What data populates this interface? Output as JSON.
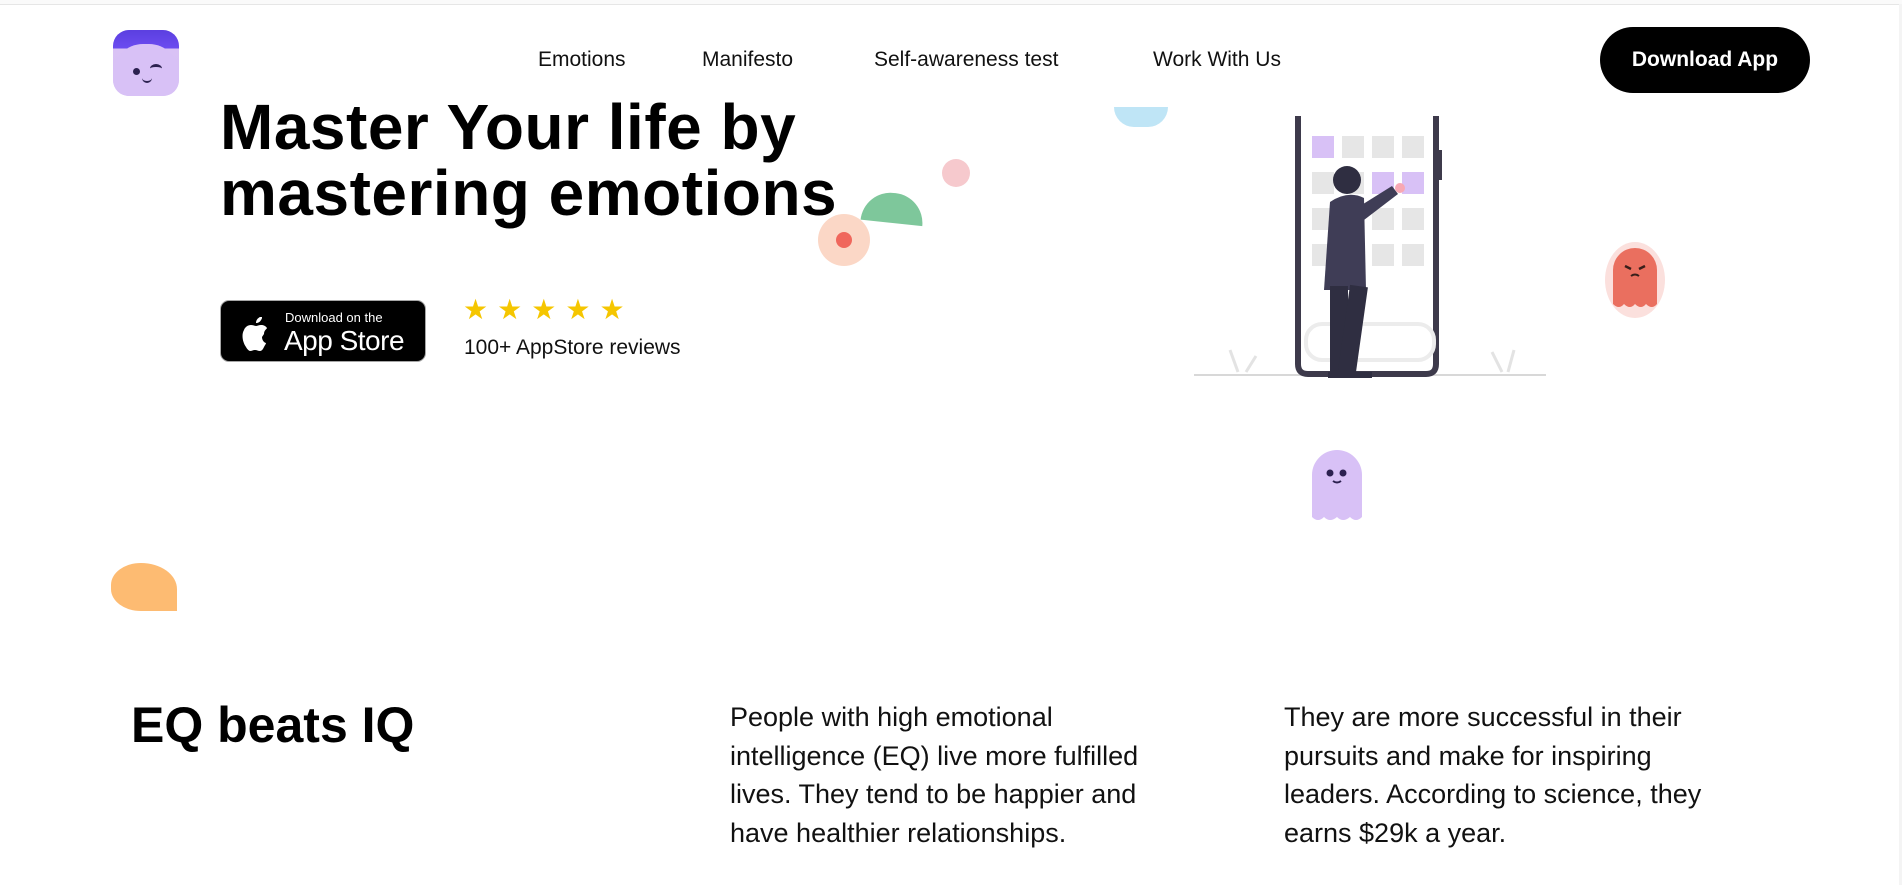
{
  "nav": {
    "items": [
      {
        "label": "Emotions"
      },
      {
        "label": "Manifesto"
      },
      {
        "label": "Self-awareness test"
      },
      {
        "label": "Work With Us"
      }
    ],
    "download_button": "Download App"
  },
  "hero": {
    "title_line1": "Master Your life by",
    "title_line2": "mastering emotions",
    "app_store": {
      "small": "Download on the",
      "big": "App Store"
    },
    "rating_stars": 5,
    "reviews": "100+ AppStore reviews"
  },
  "eq": {
    "heading": "EQ beats IQ",
    "col1": "People with high emotional intelligence (EQ) live more fulfilled lives. They tend to be happier and have healthier relationships.",
    "col2": "They are more successful in their pursuits and make for inspiring leaders. According to science, they earns $29k a year."
  },
  "colors": {
    "brand_purple": "#6c4cf0",
    "ghost_purple": "#d8c1f6",
    "star_yellow": "#f5c600",
    "button_black": "#000000"
  }
}
